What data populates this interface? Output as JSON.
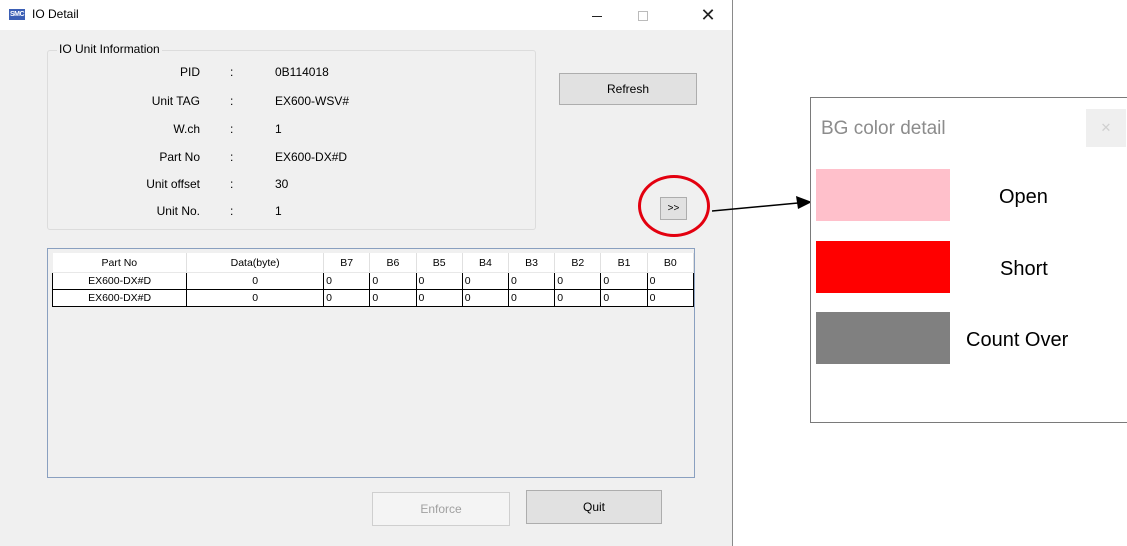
{
  "window": {
    "title": "IO Detail",
    "app_icon_text": "SMC",
    "close_glyph": "✕"
  },
  "unit_info": {
    "legend": "IO Unit Information",
    "fields": [
      {
        "label": "PID",
        "value": "0B114018"
      },
      {
        "label": "Unit TAG",
        "value": "EX600-WSV#"
      },
      {
        "label": "W.ch",
        "value": "1"
      },
      {
        "label": "Part No",
        "value": "EX600-DX#D"
      },
      {
        "label": "Unit offset",
        "value": "30"
      },
      {
        "label": "Unit No.",
        "value": "1"
      }
    ],
    "colon": ":"
  },
  "buttons": {
    "refresh": "Refresh",
    "expand": ">>",
    "enforce": "Enforce",
    "quit": "Quit"
  },
  "grid": {
    "columns": [
      "Part No",
      "Data(byte)",
      "B7",
      "B6",
      "B5",
      "B4",
      "B3",
      "B2",
      "B1",
      "B0"
    ],
    "rows": [
      [
        "EX600-DX#D",
        "0",
        "0",
        "0",
        "0",
        "0",
        "0",
        "0",
        "0",
        "0"
      ],
      [
        "EX600-DX#D",
        "0",
        "0",
        "0",
        "0",
        "0",
        "0",
        "0",
        "0",
        "0"
      ]
    ]
  },
  "bg_detail": {
    "title": "BG color detail",
    "close_glyph": "✕",
    "legend": [
      {
        "label": "Open",
        "color": "#ffc0cb"
      },
      {
        "label": "Short",
        "color": "#ff0000"
      },
      {
        "label": "Count Over",
        "color": "#808080"
      }
    ]
  },
  "colors": {
    "annotation_circle": "#e3000f"
  }
}
